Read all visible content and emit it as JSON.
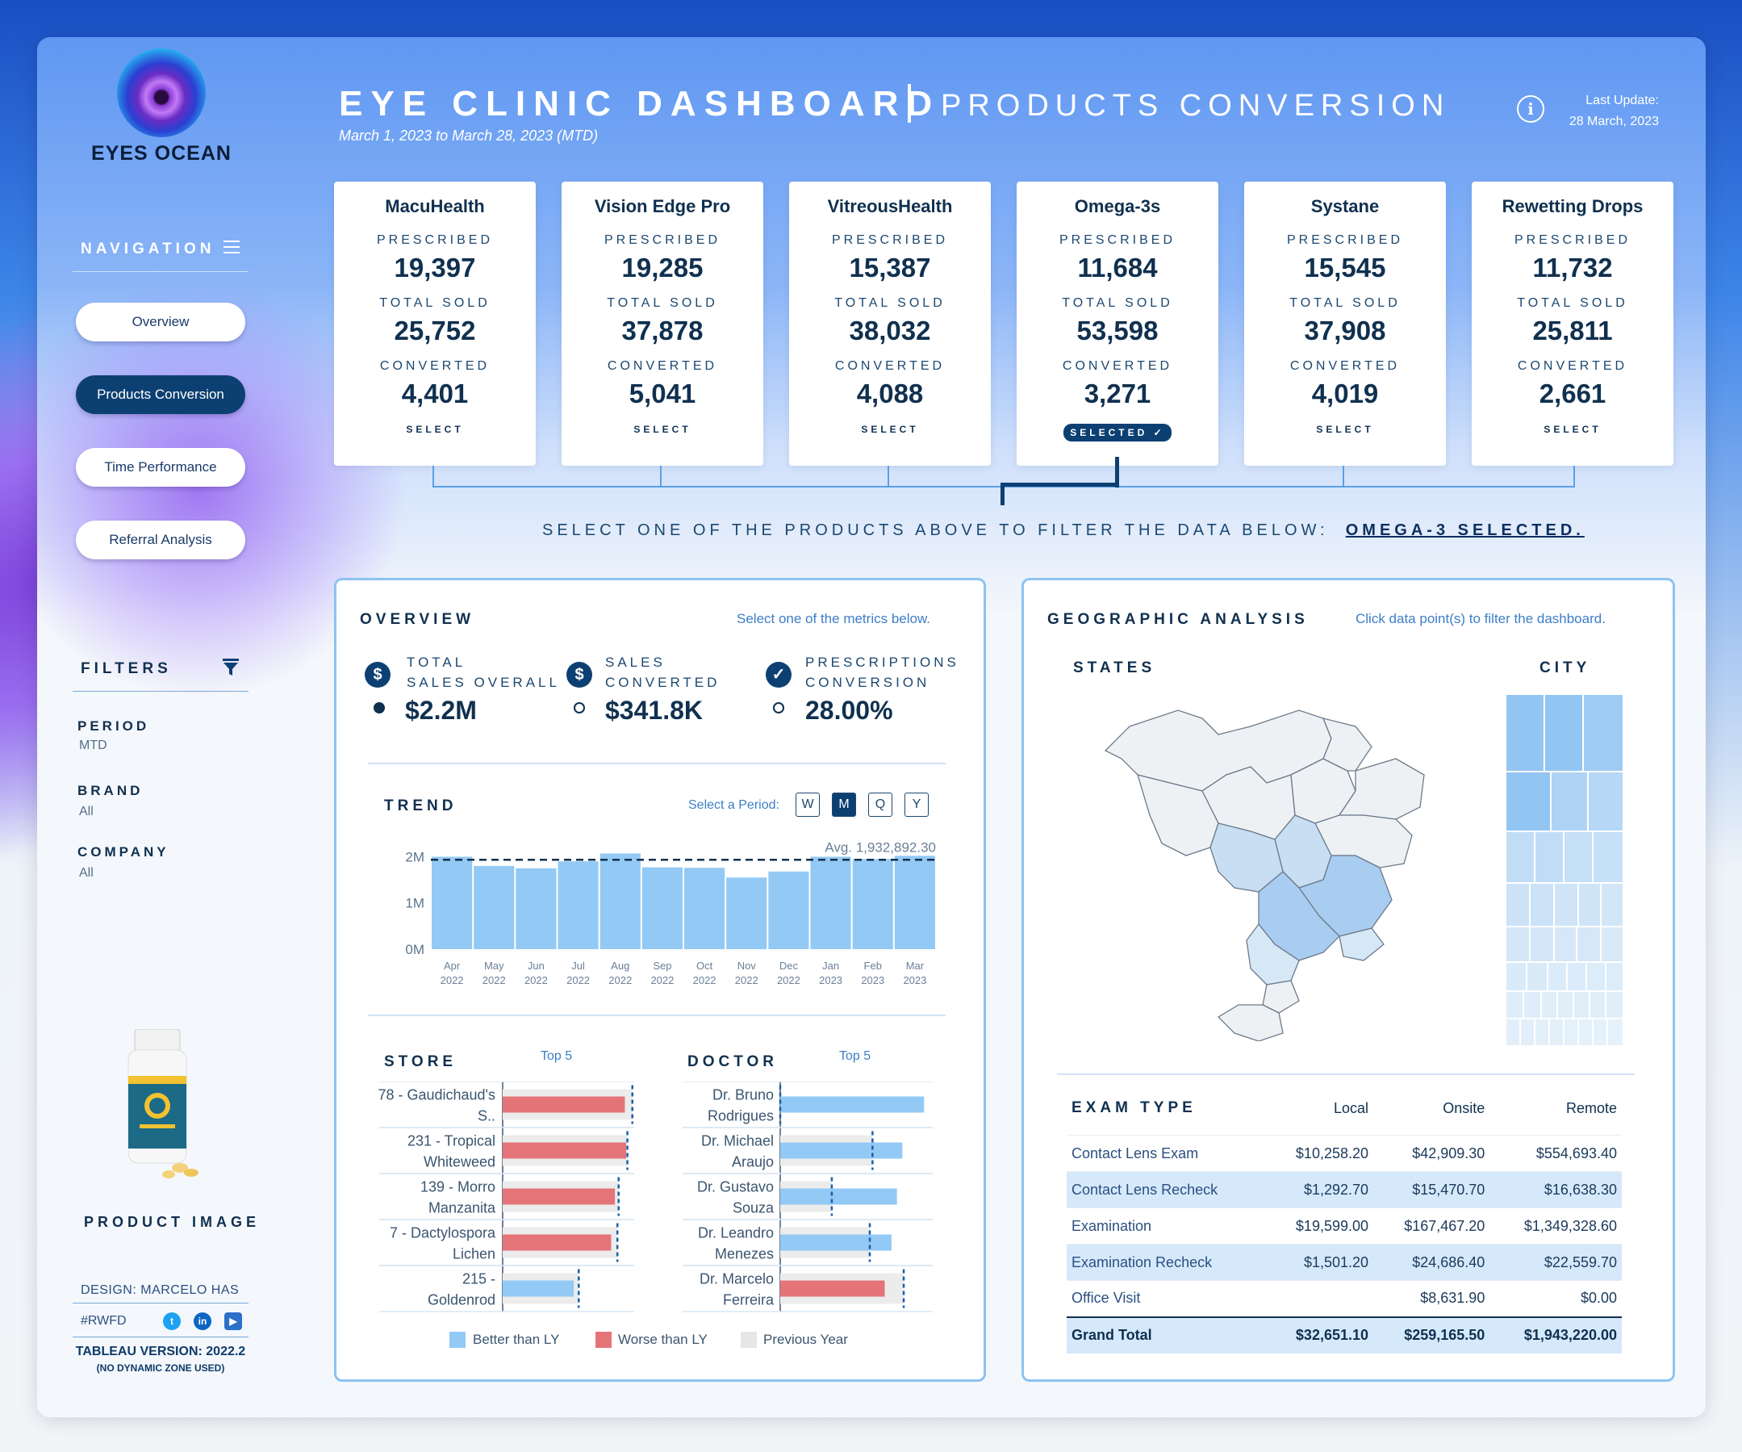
{
  "brand": {
    "name": "EYES OCEAN"
  },
  "header": {
    "title": "EYE CLINIC DASHBOARD",
    "subtitle": "PRODUCTS CONVERSION",
    "date_range": "March 1, 2023 to March 28, 2023     (MTD)",
    "last_update_label": "Last Update:",
    "last_update_value": "28 March, 2023"
  },
  "navigation": {
    "title": "NAVIGATION",
    "items": [
      {
        "label": "Overview",
        "active": false
      },
      {
        "label": "Products Conversion",
        "active": true
      },
      {
        "label": "Time Performance",
        "active": false
      },
      {
        "label": "Referral Analysis",
        "active": false
      }
    ]
  },
  "filters": {
    "title": "FILTERS",
    "items": [
      {
        "label": "PERIOD",
        "value": "MTD"
      },
      {
        "label": "BRAND",
        "value": "All"
      },
      {
        "label": "COMPANY",
        "value": "All"
      }
    ]
  },
  "sidebar_footer": {
    "product_image_label": "PRODUCT IMAGE",
    "design": "DESIGN:  MARCELO HAS",
    "hashtag": "#RWFD",
    "tableau_version": "TABLEAU VERSION: 2022.2",
    "tableau_note": "(NO DYNAMIC ZONE USED)"
  },
  "products": [
    {
      "name": "MacuHealth",
      "prescribed": "19,397",
      "total_sold": "25,752",
      "converted": "4,401",
      "select": "SELECT",
      "selected": false
    },
    {
      "name": "Vision Edge Pro",
      "prescribed": "19,285",
      "total_sold": "37,878",
      "converted": "5,041",
      "select": "SELECT",
      "selected": false
    },
    {
      "name": "VitreousHealth",
      "prescribed": "15,387",
      "total_sold": "38,032",
      "converted": "4,088",
      "select": "SELECT",
      "selected": false
    },
    {
      "name": "Omega-3s",
      "prescribed": "11,684",
      "total_sold": "53,598",
      "converted": "3,271",
      "select": "SELECTED ✓",
      "selected": true
    },
    {
      "name": "Systane",
      "prescribed": "15,545",
      "total_sold": "37,908",
      "converted": "4,019",
      "select": "SELECT",
      "selected": false
    },
    {
      "name": "Rewetting Drops",
      "prescribed": "11,732",
      "total_sold": "25,811",
      "converted": "2,661",
      "select": "SELECT",
      "selected": false
    }
  ],
  "card_labels": {
    "prescribed": "PRESCRIBED",
    "total_sold": "TOTAL SOLD",
    "converted": "CONVERTED"
  },
  "instruction": {
    "text": "SELECT ONE OF THE PRODUCTS ABOVE TO FILTER THE DATA BELOW:",
    "selected": "OMEGA-3 SELECTED."
  },
  "overview": {
    "title": "OVERVIEW",
    "hint": "Select one of the metrics below.",
    "metrics": [
      {
        "label_1": "TOTAL",
        "label_2": "SALES OVERALL",
        "value": "$2.2M",
        "icon": "dollar-icon"
      },
      {
        "label_1": "SALES",
        "label_2": "CONVERTED",
        "value": "$341.8K",
        "icon": "dollar-icon"
      },
      {
        "label_1": "PRESCRIPTIONS",
        "label_2": "CONVERSION",
        "value": "28.00%",
        "icon": "check-badge-icon"
      }
    ]
  },
  "trend": {
    "title": "TREND",
    "period_label": "Select a Period:",
    "periods": [
      "W",
      "M",
      "Q",
      "Y"
    ],
    "active_period": "M"
  },
  "store": {
    "title": "STORE",
    "top_label": "Top 5"
  },
  "doctor": {
    "title": "DOCTOR",
    "top_label": "Top 5"
  },
  "legend": {
    "items": [
      {
        "label": "Better than LY",
        "color": "#93c9f5"
      },
      {
        "label": "Worse than LY",
        "color": "#e57479"
      },
      {
        "label": "Previous Year",
        "color": "#e6e6e6"
      }
    ]
  },
  "geo": {
    "title": "GEOGRAPHIC ANALYSIS",
    "hint": "Click data point(s) to filter the dashboard.",
    "states_label": "STATES",
    "city_label": "CITY"
  },
  "exam_type": {
    "title": "EXAM TYPE",
    "columns": [
      "Local",
      "Onsite",
      "Remote"
    ],
    "rows": [
      {
        "name": "Contact Lens Exam",
        "values": [
          "$10,258.20",
          "$42,909.30",
          "$554,693.40"
        ],
        "highlight": false
      },
      {
        "name": "Contact Lens Recheck",
        "values": [
          "$1,292.70",
          "$15,470.70",
          "$16,638.30"
        ],
        "highlight": true
      },
      {
        "name": "Examination",
        "values": [
          "$19,599.00",
          "$167,467.20",
          "$1,349,328.60"
        ],
        "highlight": false
      },
      {
        "name": "Examination Recheck",
        "values": [
          "$1,501.20",
          "$24,686.40",
          "$22,559.70"
        ],
        "highlight": true
      },
      {
        "name": "Office Visit",
        "values": [
          "",
          "$8,631.90",
          "$0.00"
        ],
        "highlight": false
      }
    ],
    "total": {
      "name": "Grand Total",
      "values": [
        "$32,651.10",
        "$259,165.50",
        "$1,943,220.00"
      ]
    }
  },
  "chart_data": [
    {
      "type": "bar",
      "title": "TREND",
      "categories": [
        "Apr 2022",
        "May 2022",
        "Jun 2022",
        "Jul 2022",
        "Aug 2022",
        "Sep 2022",
        "Oct 2022",
        "Nov 2022",
        "Dec 2022",
        "Jan 2023",
        "Feb 2023",
        "Mar 2023"
      ],
      "values": [
        2000000,
        1800000,
        1750000,
        1900000,
        2070000,
        1770000,
        1760000,
        1550000,
        1680000,
        2000000,
        1950000,
        2020000
      ],
      "reference_line": {
        "label": "Avg. 1,932,892.30",
        "value": 1932892.3
      },
      "yticks": [
        "0M",
        "1M",
        "2M"
      ],
      "ylim": [
        0,
        2200000
      ],
      "color": "#93c9f5"
    },
    {
      "type": "bar",
      "title": "STORE",
      "subtitle": "Top 5",
      "categories": [
        "78 - Gaudichaud's S..",
        "231 - Tropical Whiteweed",
        "139 - Morro Manzanita",
        "7 - Dactylospora Lichen",
        "215 - Goldenrod"
      ],
      "series": [
        {
          "name": "Current",
          "values": [
            9.8,
            9.9,
            9.0,
            8.7,
            5.7
          ],
          "status": [
            "worse",
            "worse",
            "worse",
            "worse",
            "better"
          ]
        },
        {
          "name": "Previous Year",
          "values": [
            10.4,
            10.0,
            9.3,
            9.2,
            6.1
          ]
        }
      ],
      "xlim": [
        0,
        11
      ]
    },
    {
      "type": "bar",
      "title": "DOCTOR",
      "subtitle": "Top 5",
      "categories": [
        "Dr. Bruno Rodrigues",
        "Dr. Michael Araujo",
        "Dr. Gustavo Souza",
        "Dr. Leandro Menezes",
        "Dr. Marcelo Ferreira"
      ],
      "series": [
        {
          "name": "Current",
          "values": [
            10.6,
            9.0,
            8.6,
            8.2,
            7.7
          ],
          "status": [
            "better",
            "better",
            "better",
            "better",
            "worse"
          ]
        },
        {
          "name": "Previous Year",
          "values": [
            0.0,
            6.8,
            3.8,
            6.6,
            9.1
          ]
        }
      ],
      "xlim": [
        0,
        11
      ]
    }
  ]
}
